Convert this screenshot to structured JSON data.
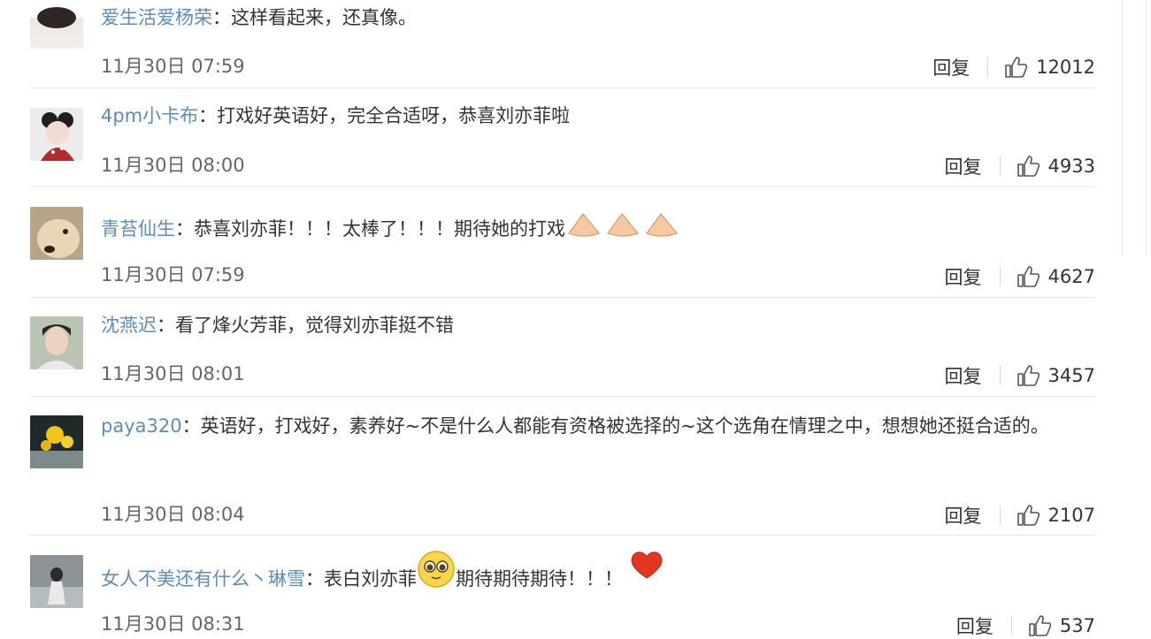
{
  "comments": [
    {
      "user": "爱生活爱杨荣",
      "text": "这样看起来，还真像。",
      "time": "11月30日 07:59",
      "reply": "回复",
      "likes": "12012"
    },
    {
      "user": "4pm小卡布",
      "text": "打戏好英语好，完全合适呀，恭喜刘亦菲啦",
      "time": "11月30日 08:00",
      "reply": "回复",
      "likes": "4933"
    },
    {
      "user": "青苔仙生",
      "text": "恭喜刘亦菲！！！太棒了！！！期待她的打戏",
      "time": "11月30日 07:59",
      "reply": "回复",
      "likes": "4627"
    },
    {
      "user": "沈燕迟",
      "text": "看了烽火芳菲，觉得刘亦菲挺不错",
      "time": "11月30日 08:01",
      "reply": "回复",
      "likes": "3457"
    },
    {
      "user": "paya320",
      "text": "英语好，打戏好，素养好~不是什么人都能有资格被选择的~这个选角在情理之中，想想她还挺合适的。",
      "time": "11月30日 08:04",
      "reply": "回复",
      "likes": "2107"
    },
    {
      "user": "女人不美还有什么丶琳雪",
      "text_before": "表白刘亦菲",
      "text_after": "期待期待期待！！！",
      "time": "11月30日 08:31",
      "reply": "回复",
      "likes": "537"
    }
  ],
  "separator": "："
}
